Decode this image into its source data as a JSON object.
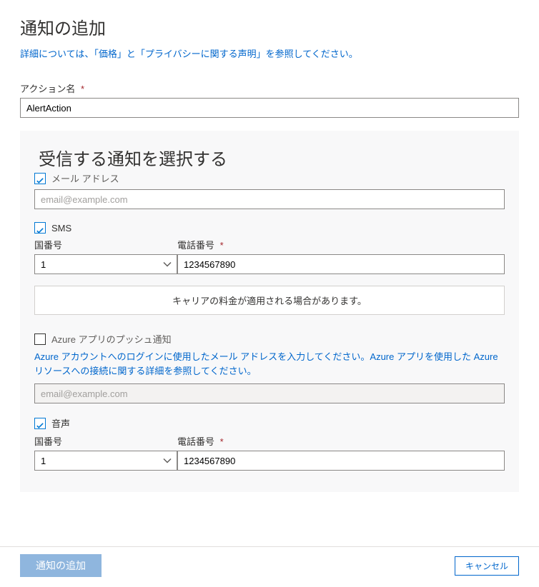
{
  "header": {
    "title": "通知の追加",
    "help_text": "詳細については、「価格」と「プライバシーに関する声明」を参照してください。"
  },
  "action_name": {
    "label": "アクション名",
    "value": "AlertAction"
  },
  "panel": {
    "title": "受信する通知を選択する"
  },
  "email": {
    "label": "メール アドレス",
    "placeholder": "email@example.com",
    "value": ""
  },
  "sms": {
    "label": "SMS",
    "country_label": "国番号",
    "country_value": "1",
    "phone_label": "電話番号",
    "phone_value": "1234567890",
    "carrier_notice": "キャリアの料金が適用される場合があります。"
  },
  "push": {
    "label": "Azure アプリのプッシュ通知",
    "help_text": "Azure アカウントへのログインに使用したメール アドレスを入力してください。Azure アプリを使用した Azure リソースへの接続に関する詳細を参照してください。",
    "placeholder": "email@example.com",
    "value": ""
  },
  "voice": {
    "label": "音声",
    "country_label": "国番号",
    "country_value": "1",
    "phone_label": "電話番号",
    "phone_value": "1234567890"
  },
  "footer": {
    "submit_label": "通知の追加",
    "cancel_label": "キャンセル"
  },
  "required_mark": "*"
}
